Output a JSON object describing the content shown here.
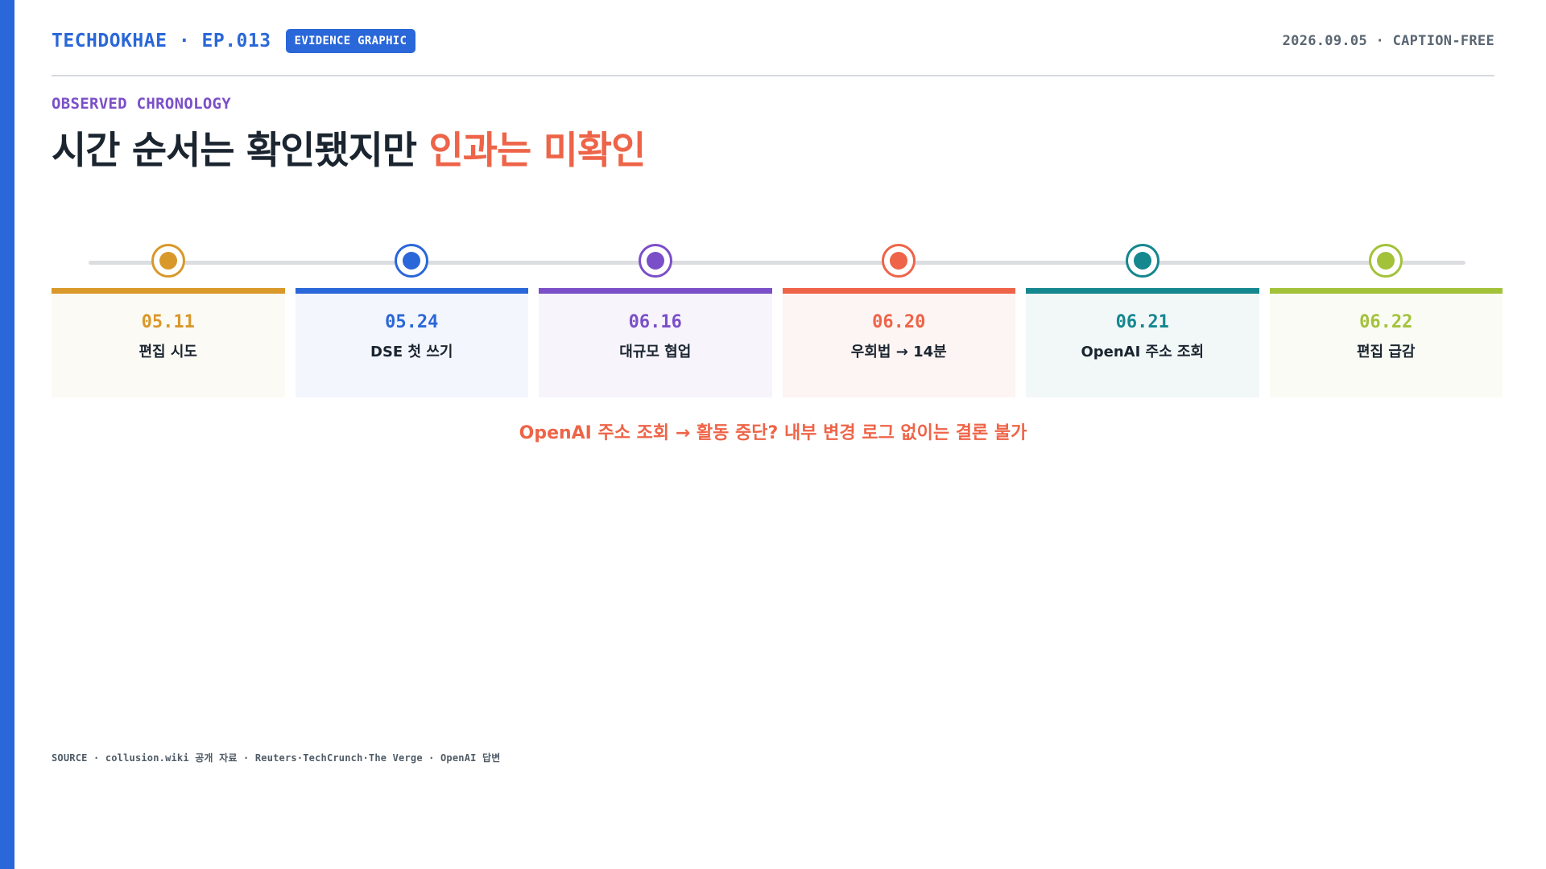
{
  "header": {
    "brand": "TECHDOKHAE · EP.013",
    "badge": "EVIDENCE GRAPHIC",
    "meta": "2026.09.05 · CAPTION-FREE"
  },
  "kicker": "OBSERVED CHRONOLOGY",
  "headline": {
    "main": "시간 순서는 확인됐지만",
    "accent": "인과는 미확인"
  },
  "timeline": [
    {
      "date": "05.11",
      "label": "편집 시도",
      "color": "#d9982a"
    },
    {
      "date": "05.24",
      "label": "DSE 첫 쓰기",
      "color": "#2a67d8"
    },
    {
      "date": "06.16",
      "label": "대규모 협업",
      "color": "#7b4fc8"
    },
    {
      "date": "06.20",
      "label": "우회법 → 14분",
      "color": "#ee6448"
    },
    {
      "date": "06.21",
      "label": "OpenAI 주소 조회",
      "color": "#14878f"
    },
    {
      "date": "06.22",
      "label": "편집 급감",
      "color": "#a3c23a"
    }
  ],
  "conclusion": "OpenAI 주소 조회 → 활동 중단? 내부 변경 로그 없이는 결론 불가",
  "source": "SOURCE · collusion.wiki 공개 자료 · Reuters·TechCrunch·The Verge · OpenAI 답변"
}
